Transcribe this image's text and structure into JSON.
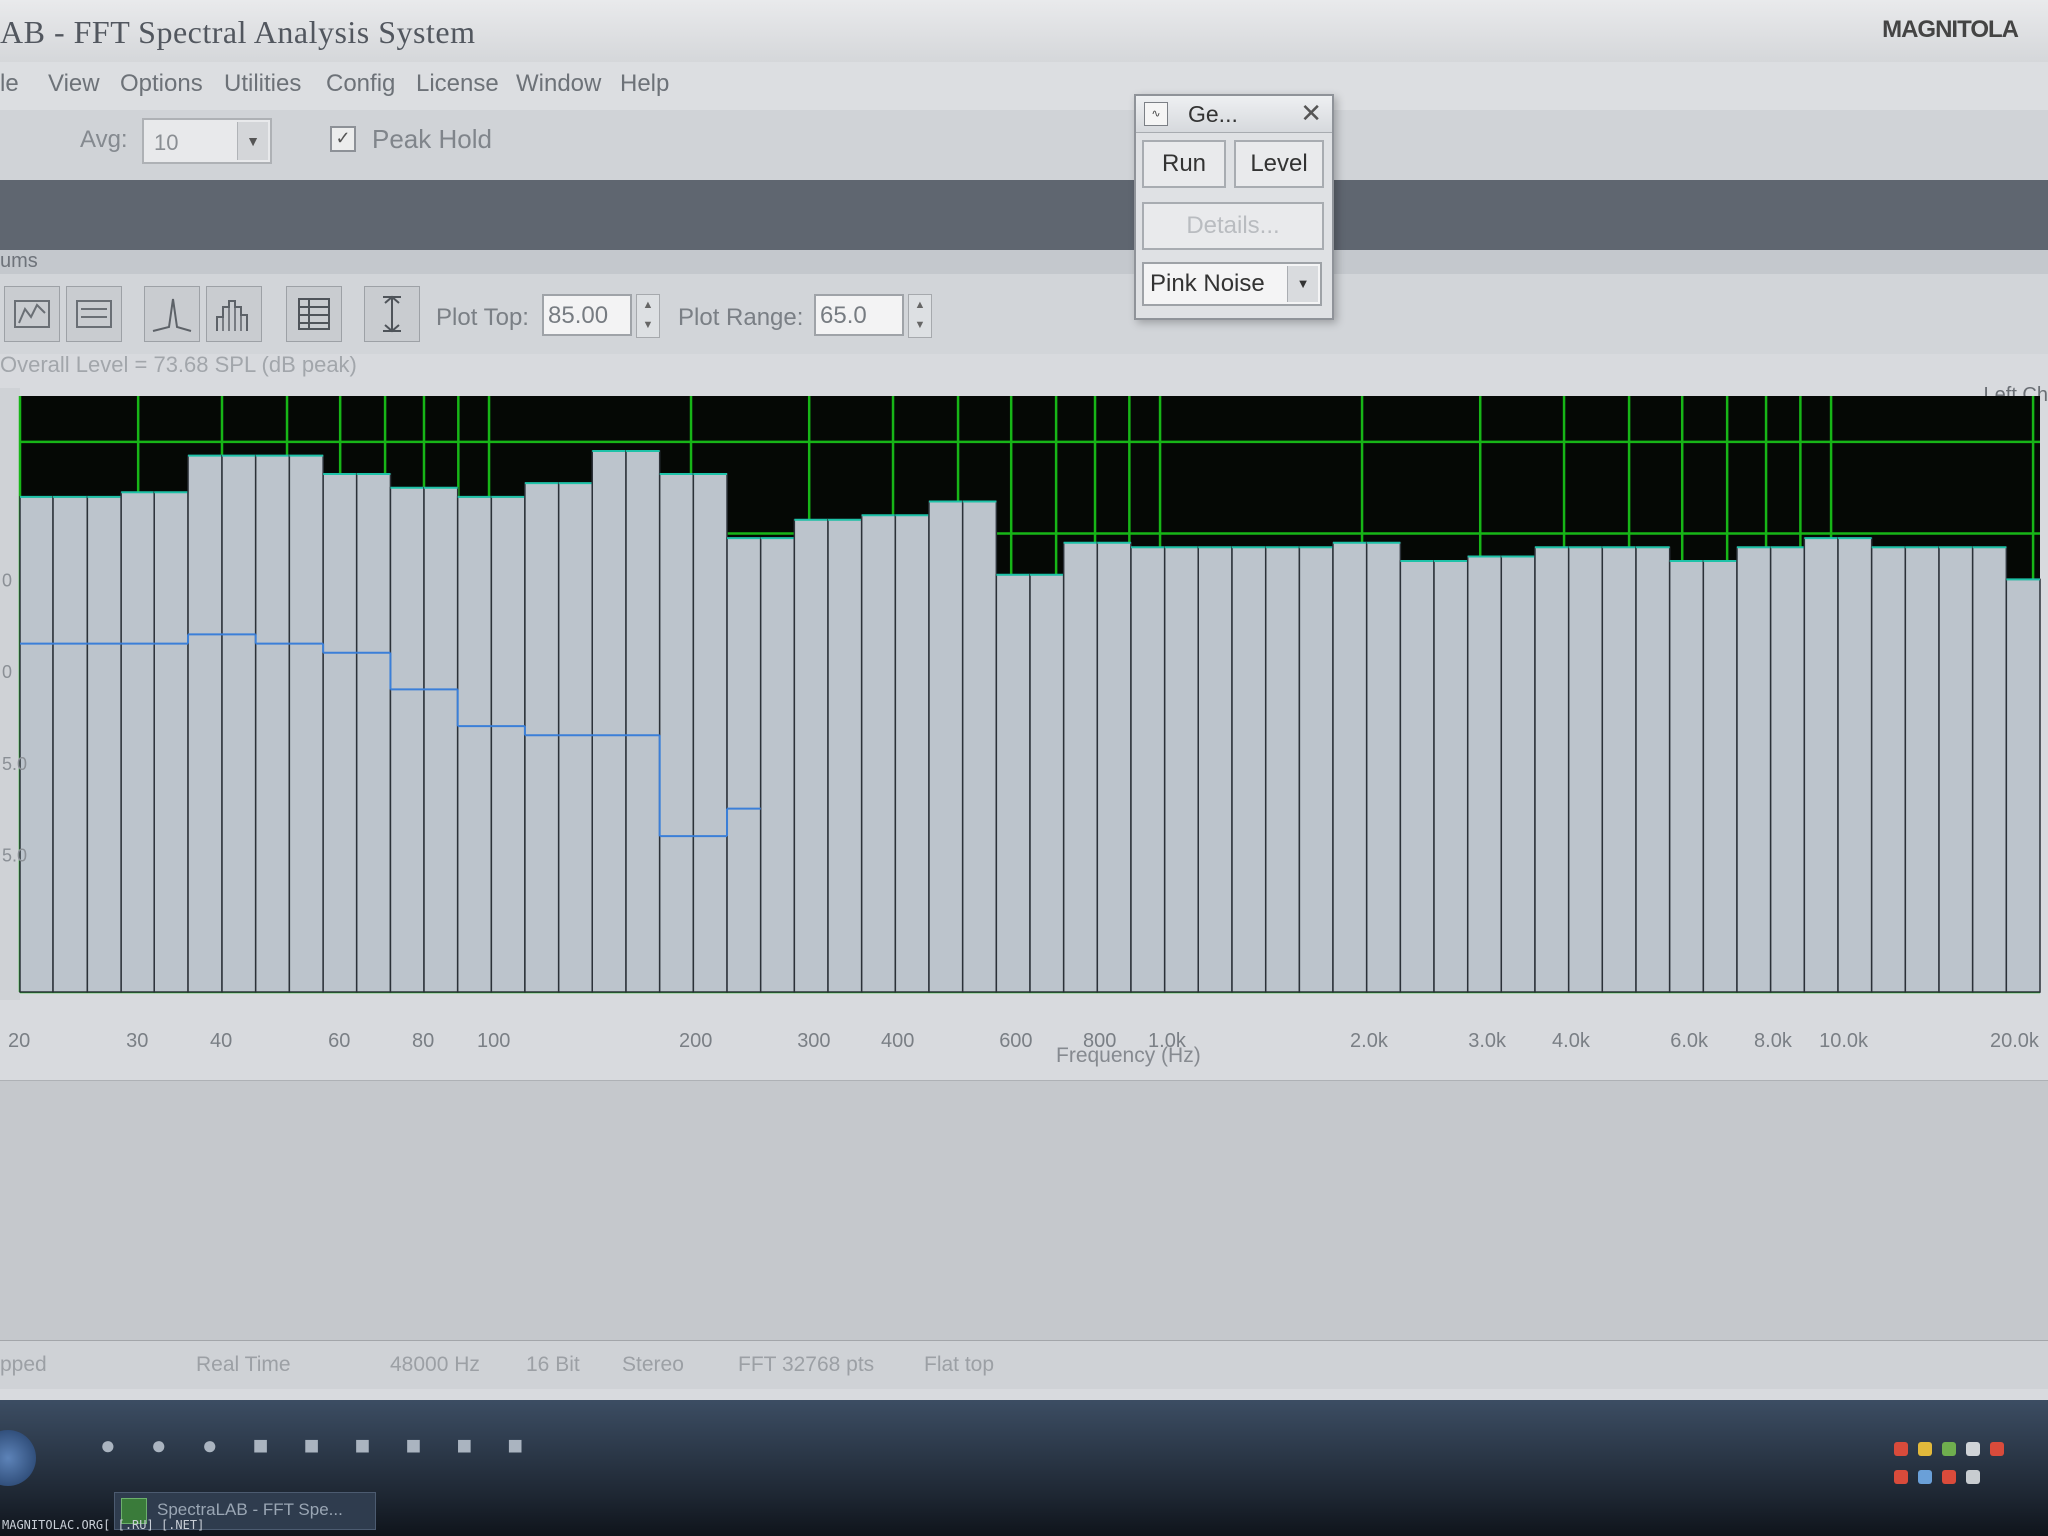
{
  "window": {
    "title": "AB - FFT Spectral Analysis System",
    "logo_text": "MAGNITOLA"
  },
  "menu": [
    "le",
    "View",
    "Options",
    "Utilities",
    "Config",
    "License",
    "Window",
    "Help"
  ],
  "toolbar": {
    "avg_label": "Avg:",
    "avg_value": "10",
    "peak_hold_label": "Peak Hold",
    "peak_hold_checked": true
  },
  "section_label": "ums",
  "plot_controls": {
    "plot_top_label": "Plot Top:",
    "plot_top_value": "85.00",
    "plot_range_label": "Plot Range:",
    "plot_range_value": "65.0"
  },
  "overall_level": "Overall Level = 73.68 SPL (dB peak)",
  "channel_label": "Left Ch",
  "chart_data": {
    "type": "bar",
    "xlabel": "Frequency (Hz)",
    "x_scale": "log",
    "x_ticks": [
      "20",
      "30",
      "40",
      "60",
      "80",
      "100",
      "200",
      "300",
      "400",
      "600",
      "800",
      "1.0k",
      "2.0k",
      "3.0k",
      "4.0k",
      "6.0k",
      "8.0k",
      "10.0k",
      "20.0k"
    ],
    "y_ticks_visible": [
      "0",
      "0",
      "5.0",
      "5.0"
    ],
    "band_edges_hz": [
      20,
      22.4,
      25.2,
      28.3,
      31.7,
      35.6,
      40,
      44.9,
      50.4,
      56.6,
      63.5,
      71.3,
      80,
      89.8,
      100.8,
      113.1,
      127,
      142.5,
      160,
      179.6,
      201.6,
      226.3,
      254,
      285.1,
      320,
      359.2,
      403.2,
      452.5,
      508,
      570.2,
      640,
      718.4,
      806.3,
      905,
      1016,
      1140,
      1280,
      1437,
      1613,
      1810,
      2032,
      2281,
      2560,
      2874,
      3225,
      3620,
      4064,
      4561,
      5120,
      5747,
      6451,
      7240,
      8127,
      9123,
      10240,
      11494,
      12902,
      14482,
      16255,
      18246,
      20480
    ],
    "ylim": [
      20,
      85
    ],
    "series": [
      {
        "values": [
          74,
          74,
          74,
          74.5,
          74.5,
          78.5,
          78.5,
          78.5,
          78.5,
          76.5,
          76.5,
          75,
          75,
          74,
          74,
          75.5,
          75.5,
          79,
          79,
          76.5,
          76.5,
          69.5,
          69.5,
          71.5,
          71.5,
          72,
          72,
          73.5,
          73.5,
          65.5,
          65.5,
          69,
          69,
          68.5,
          68.5,
          68.5,
          68.5,
          68.5,
          68.5,
          69,
          69,
          67,
          67,
          67.5,
          67.5,
          68.5,
          68.5,
          68.5,
          68.5,
          67,
          67,
          68.5,
          68.5,
          69.5,
          69.5,
          68.5,
          68.5,
          68.5,
          68.5,
          65
        ],
        "color": "#bcc4cc"
      },
      {
        "values": [
          58,
          58,
          58,
          58,
          58,
          59,
          59,
          58,
          58,
          57,
          57,
          53,
          53,
          49,
          49,
          48,
          48,
          48,
          48,
          37,
          37,
          40
        ],
        "color": "#3b7fd8"
      }
    ],
    "grid": true,
    "grid_color": "#17b517",
    "background_color": "#050805"
  },
  "generator": {
    "title": "Ge...",
    "run_label": "Run",
    "level_label": "Level",
    "details_label": "Details...",
    "signal_value": "Pink Noise"
  },
  "status": [
    "pped",
    "Real Time",
    "48000 Hz",
    "16 Bit",
    "Stereo",
    "FFT 32768 pts",
    "Flat top"
  ],
  "taskbar": {
    "app_label": "SpectraLAB - FFT Spe...",
    "credit": "MAGNITOLAC.ORG[ [.RU] [.NET]"
  }
}
